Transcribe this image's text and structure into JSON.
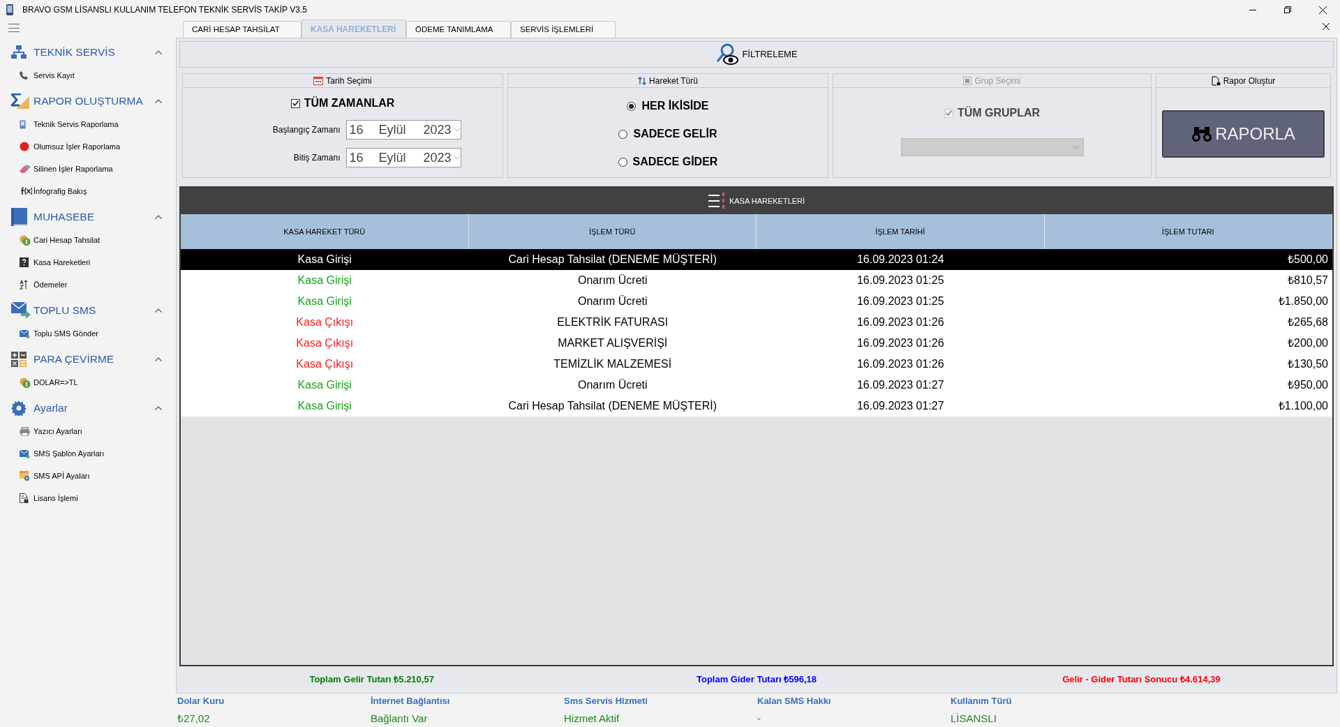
{
  "window": {
    "title": "BRAVO GSM LİSANSLI KULLANIM TELEFON TEKNİK SERVİS TAKİP V3.5"
  },
  "sidebar": {
    "sections": [
      {
        "title": "TEKNİK SERVİS",
        "expanded": true,
        "items": [
          {
            "label": "Servis Kayıt"
          }
        ]
      },
      {
        "title": "RAPOR OLUŞTURMA",
        "expanded": true,
        "items": [
          {
            "label": "Teknik Servis Raporlama"
          },
          {
            "label": "Olumsuz İşler Raporlama"
          },
          {
            "label": "Silinen İşler Raporlama"
          },
          {
            "label": "İnfografig Bakış"
          }
        ]
      },
      {
        "title": "MUHASEBE",
        "expanded": true,
        "items": [
          {
            "label": "Cari Hesap Tahsilat"
          },
          {
            "label": "Kasa Hareketleri"
          },
          {
            "label": "Ödemeler"
          }
        ]
      },
      {
        "title": "TOPLU SMS",
        "expanded": true,
        "items": [
          {
            "label": "Toplu SMS Gönder"
          }
        ]
      },
      {
        "title": "PARA ÇEVİRME",
        "expanded": true,
        "items": [
          {
            "label": "DOLAR=>TL"
          }
        ]
      },
      {
        "title": "Ayarlar",
        "expanded": true,
        "items": [
          {
            "label": "Yazıcı Ayarları"
          },
          {
            "label": "SMS Şablon Ayarları"
          },
          {
            "label": "SMS APİ Ayaları"
          },
          {
            "label": "Lisans İşlemi"
          }
        ]
      }
    ]
  },
  "tabs": [
    {
      "label": "CARİ HESAP TAHSİLAT",
      "selected": false
    },
    {
      "label": "KASA HAREKETLERİ",
      "selected": true
    },
    {
      "label": "ÖDEME TANIMLAMA",
      "selected": false
    },
    {
      "label": "SERVİS İŞLEMLERİ",
      "selected": false
    }
  ],
  "filter": {
    "title": "FİLTRELEME",
    "date_group": {
      "title": "Tarih Seçimi",
      "all_times": {
        "label": "TÜM ZAMANLAR",
        "checked": true
      },
      "start": {
        "label": "Başlangıç Zamanı",
        "day": "16",
        "month": "Eylül",
        "year": "2023"
      },
      "end": {
        "label": "Bitiş Zamanı",
        "day": "16",
        "month": "Eylül",
        "year": "2023"
      }
    },
    "movement_group": {
      "title": "Hareket Türü",
      "options": [
        {
          "label": "HER İKİSİDE",
          "selected": true
        },
        {
          "label": "SADECE GELİR",
          "selected": false
        },
        {
          "label": "SADECE GİDER",
          "selected": false
        }
      ]
    },
    "group_group": {
      "title": "Grup Seçimi",
      "all_groups": {
        "label": "TÜM GRUPLAR",
        "checked": true,
        "disabled": true
      }
    },
    "report_group": {
      "title": "Rapor Oluştur",
      "button": "RAPORLA"
    }
  },
  "table": {
    "title": "KASA HAREKETLERİ",
    "columns": [
      "KASA HAREKET TÜRÜ",
      "İŞLEM TÜRÜ",
      "İŞLEM TARİHİ",
      "İŞLEM TUTARI"
    ],
    "rows": [
      {
        "kind": "in",
        "selected": true,
        "cells": [
          "Kasa Girişi",
          "Cari Hesap Tahsilat (DENEME MÜŞTERİ)",
          "16.09.2023 01:24",
          "₺500,00"
        ]
      },
      {
        "kind": "in",
        "selected": false,
        "cells": [
          "Kasa Girişi",
          "Onarım Ücreti",
          "16.09.2023 01:25",
          "₺810,57"
        ]
      },
      {
        "kind": "in",
        "selected": false,
        "cells": [
          "Kasa Girişi",
          "Onarım Ücreti",
          "16.09.2023 01:25",
          "₺1.850,00"
        ]
      },
      {
        "kind": "out",
        "selected": false,
        "cells": [
          "Kasa Çıkışı",
          "ELEKTRİK FATURASI",
          "16.09.2023 01:26",
          "₺265,68"
        ]
      },
      {
        "kind": "out",
        "selected": false,
        "cells": [
          "Kasa Çıkışı",
          "MARKET ALIŞVERİŞİ",
          "16.09.2023 01:26",
          "₺200,00"
        ]
      },
      {
        "kind": "out",
        "selected": false,
        "cells": [
          "Kasa Çıkışı",
          "TEMİZLİK MALZEMESİ",
          "16.09.2023 01:26",
          "₺130,50"
        ]
      },
      {
        "kind": "in",
        "selected": false,
        "cells": [
          "Kasa Girişi",
          "Onarım Ücreti",
          "16.09.2023 01:27",
          "₺950,00"
        ]
      },
      {
        "kind": "in",
        "selected": false,
        "cells": [
          "Kasa Girişi",
          "Cari Hesap Tahsilat (DENEME MÜŞTERİ)",
          "16.09.2023 01:27",
          "₺1.100,00"
        ]
      }
    ]
  },
  "totals": [
    {
      "text": "Toplam Gelir Tutarı ₺5.210,57",
      "color": "#008000"
    },
    {
      "text": "Toplam Gider Tutarı ₺596,18",
      "color": "#0000ff"
    },
    {
      "text": "Gelir - Gider Tutarı Sonucu ₺4.614,39",
      "color": "#ff0000"
    }
  ],
  "status_bar": [
    {
      "label": "Dolar Kuru",
      "value": "₺27,02"
    },
    {
      "label": "İnternet Bağlantısı",
      "value": "Bağlantı Var"
    },
    {
      "label": "Sms Servis Hizmeti",
      "value": "Hizmet Aktif"
    },
    {
      "label": "Kalan SMS Hakkı",
      "value": "-"
    },
    {
      "label": "Kullanım Türü",
      "value": "LİSANSLI"
    }
  ]
}
